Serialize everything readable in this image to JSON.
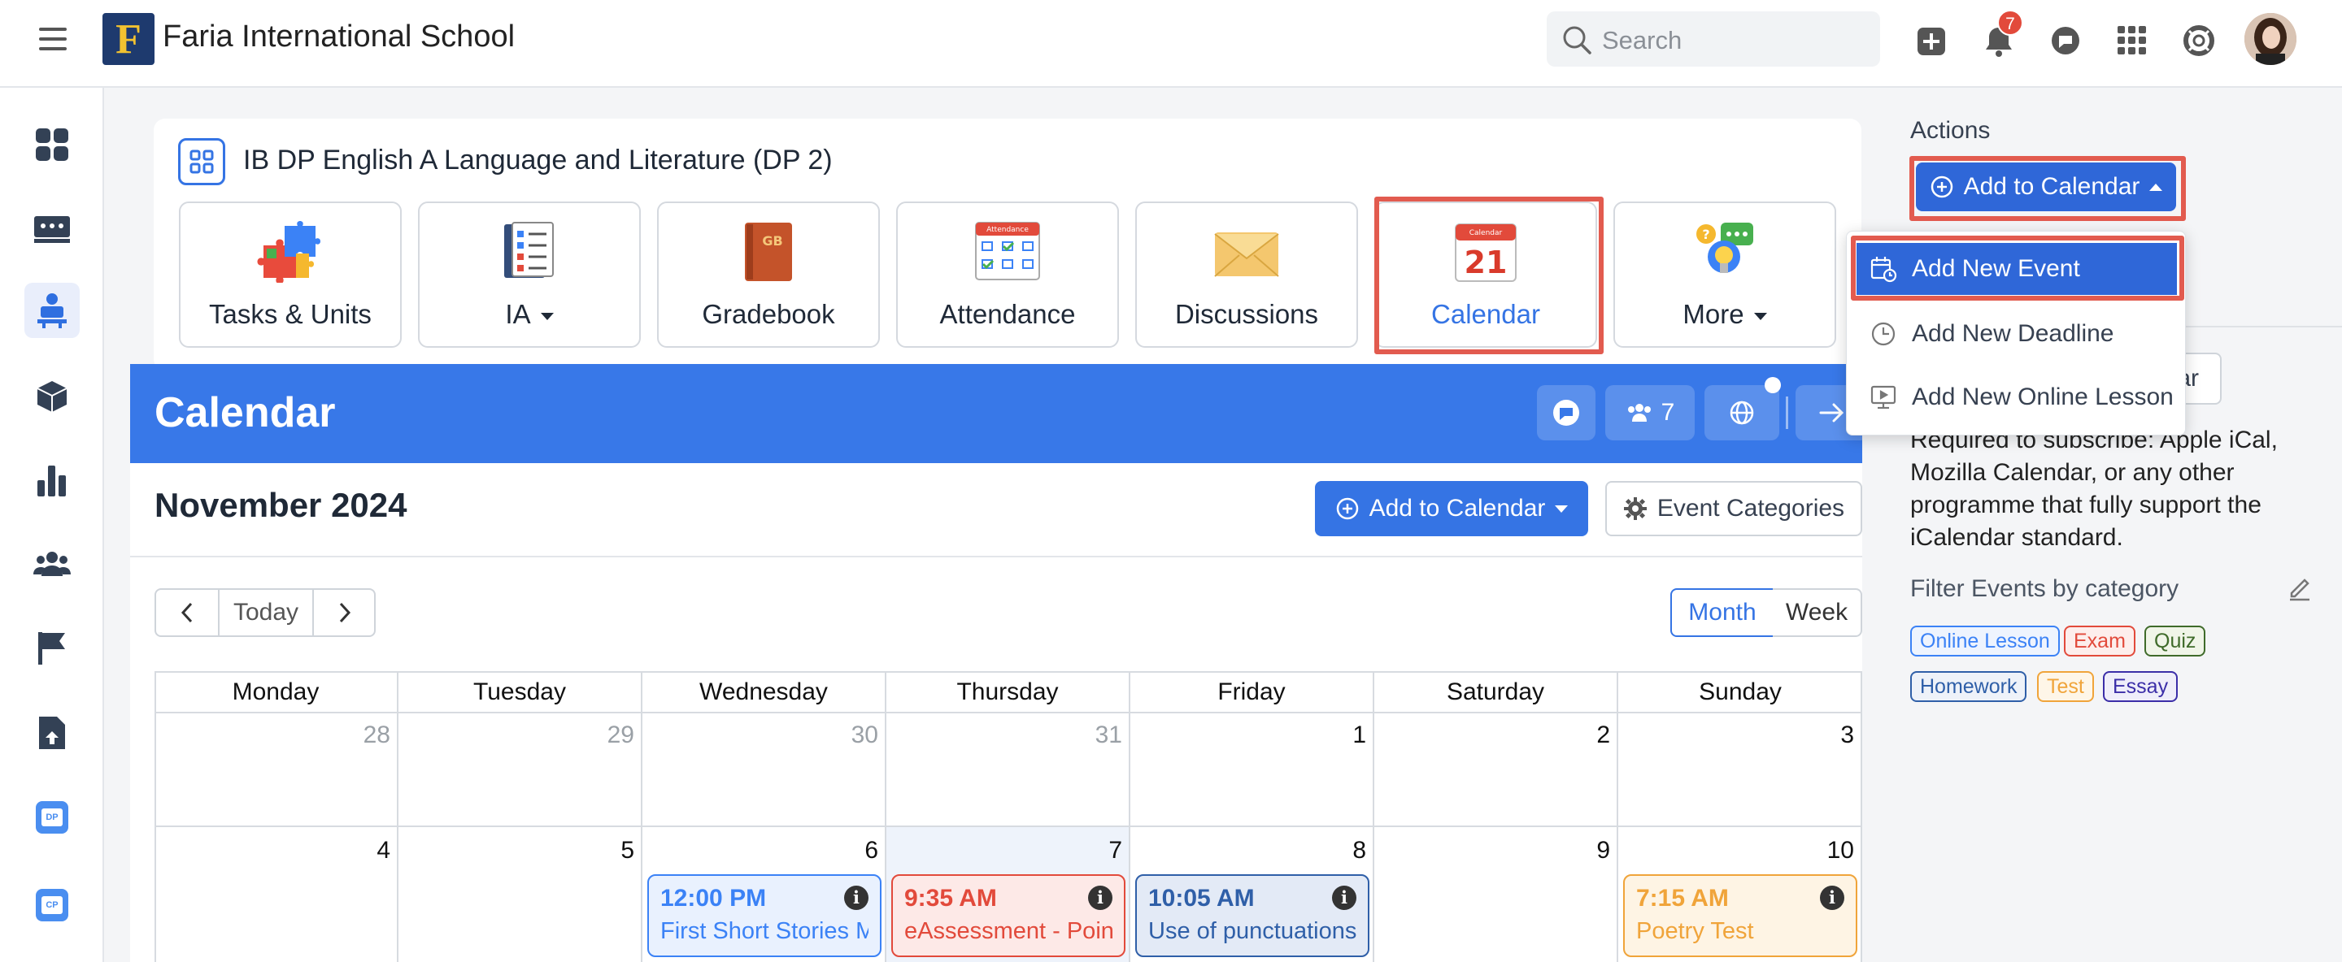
{
  "topbar": {
    "school_name": "Faria International School",
    "logo_letter": "F",
    "search_placeholder": "Search",
    "notification_count": "7"
  },
  "sidebar": {
    "items": [
      {
        "icon": "dashboard-icon",
        "active": false
      },
      {
        "icon": "classes-icon",
        "active": false
      },
      {
        "icon": "teacher-icon",
        "active": true
      },
      {
        "icon": "cube-icon",
        "active": false
      },
      {
        "icon": "chart-icon",
        "active": false
      },
      {
        "icon": "people-icon",
        "active": false
      },
      {
        "icon": "flag-icon",
        "active": false
      },
      {
        "icon": "file-icon",
        "active": false
      },
      {
        "icon": "dp-icon",
        "active": false,
        "text": "DP"
      },
      {
        "icon": "cp-icon",
        "active": false,
        "text": "CP"
      }
    ]
  },
  "course": {
    "title": "IB DP English A Language and Literature (DP 2)",
    "tools": [
      {
        "label": "Tasks & Units",
        "icon": "puzzle-icon",
        "dropdown": false,
        "active": false
      },
      {
        "label": "IA",
        "icon": "ia-checklist-icon",
        "dropdown": true,
        "active": false
      },
      {
        "label": "Gradebook",
        "icon": "gradebook-icon",
        "dropdown": false,
        "active": false,
        "icon_text": "GB"
      },
      {
        "label": "Attendance",
        "icon": "attendance-icon",
        "dropdown": false,
        "active": false,
        "icon_text": "Attendance"
      },
      {
        "label": "Discussions",
        "icon": "envelope-icon",
        "dropdown": false,
        "active": false
      },
      {
        "label": "Calendar",
        "icon": "calendar-icon",
        "dropdown": false,
        "active": true,
        "icon_text": "21",
        "icon_top_text": "Calendar"
      },
      {
        "label": "More",
        "icon": "more-bulb-icon",
        "dropdown": true,
        "active": false
      }
    ]
  },
  "calendar": {
    "header_title": "Calendar",
    "members_count": "7",
    "month_title": "November 2024",
    "add_to_calendar": "Add to Calendar",
    "event_categories": "Event Categories",
    "today": "Today",
    "view_month": "Month",
    "view_week": "Week",
    "days": [
      "Monday",
      "Tuesday",
      "Wednesday",
      "Thursday",
      "Friday",
      "Saturday",
      "Sunday"
    ],
    "week1": [
      "28",
      "29",
      "30",
      "31",
      "1",
      "2",
      "3"
    ],
    "week2": [
      "4",
      "5",
      "6",
      "7",
      "8",
      "9",
      "10"
    ],
    "events": [
      {
        "time": "12:00 PM",
        "title": "First Short Stories M",
        "color": "#3b82f6"
      },
      {
        "time": "9:35 AM",
        "title": "eAssessment - Poin",
        "color": "#e24a3b"
      },
      {
        "time": "10:05 AM",
        "title": "Use of punctuations",
        "color": "#2f5fa8"
      },
      {
        "time": "7:15 AM",
        "title": "Poetry Test",
        "color": "#f0a43a"
      }
    ]
  },
  "actions": {
    "heading": "Actions",
    "add_to_calendar": "Add to Calendar",
    "dropdown": [
      {
        "label": "Add New Event",
        "icon": "calendar-event-icon"
      },
      {
        "label": "Add New Deadline",
        "icon": "clock-icon"
      },
      {
        "label": "Add New Online Lesson",
        "icon": "presentation-icon"
      }
    ],
    "subscribe_button_partial": "ar",
    "subscribe_note": "Required to subscribe: Apple iCal, Mozilla Calendar, or any other programme that fully support the iCalendar standard.",
    "filter_heading": "Filter Events by category",
    "categories": [
      {
        "label": "Online Lesson",
        "color": "#3b82f6"
      },
      {
        "label": "Exam",
        "color": "#e24a3b"
      },
      {
        "label": "Quiz",
        "color": "#3f6b2a"
      },
      {
        "label": "Homework",
        "color": "#2f5fa8"
      },
      {
        "label": "Test",
        "color": "#f0a43a"
      },
      {
        "label": "Essay",
        "color": "#3b2ea8"
      }
    ]
  },
  "colors": {
    "primary": "#3574e4",
    "header_blue": "#3878e8",
    "highlight_red": "#e25b4f",
    "today_bg": "#eef3fb"
  }
}
